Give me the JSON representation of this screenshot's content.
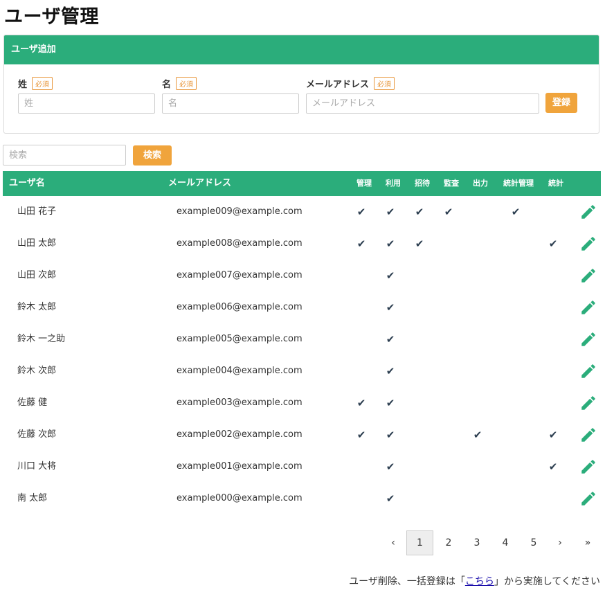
{
  "page_title": "ユーザ管理",
  "add_user": {
    "header": "ユーザ追加",
    "required_badge": "必須",
    "last_name": {
      "label": "姓",
      "placeholder": "姓"
    },
    "first_name": {
      "label": "名",
      "placeholder": "名"
    },
    "email": {
      "label": "メールアドレス",
      "placeholder": "メールアドレス"
    },
    "submit_label": "登録"
  },
  "search": {
    "placeholder": "検索",
    "button_label": "検索"
  },
  "table": {
    "columns": {
      "name": "ユーザ名",
      "email": "メールアドレス",
      "perms": [
        "管理",
        "利用",
        "招待",
        "監査",
        "出力",
        "統計管理",
        "統計"
      ]
    },
    "check_glyph": "✔",
    "rows": [
      {
        "name": "山田 花子",
        "email": "example009@example.com",
        "perms": [
          true,
          true,
          true,
          true,
          false,
          true,
          false
        ]
      },
      {
        "name": "山田 太郎",
        "email": "example008@example.com",
        "perms": [
          true,
          true,
          true,
          false,
          false,
          false,
          true
        ]
      },
      {
        "name": "山田 次郎",
        "email": "example007@example.com",
        "perms": [
          false,
          true,
          false,
          false,
          false,
          false,
          false
        ]
      },
      {
        "name": "鈴木 太郎",
        "email": "example006@example.com",
        "perms": [
          false,
          true,
          false,
          false,
          false,
          false,
          false
        ]
      },
      {
        "name": "鈴木 一之助",
        "email": "example005@example.com",
        "perms": [
          false,
          true,
          false,
          false,
          false,
          false,
          false
        ]
      },
      {
        "name": "鈴木 次郎",
        "email": "example004@example.com",
        "perms": [
          false,
          true,
          false,
          false,
          false,
          false,
          false
        ]
      },
      {
        "name": "佐藤 健",
        "email": "example003@example.com",
        "perms": [
          true,
          true,
          false,
          false,
          false,
          false,
          false
        ]
      },
      {
        "name": "佐藤 次郎",
        "email": "example002@example.com",
        "perms": [
          true,
          true,
          false,
          false,
          true,
          false,
          true
        ]
      },
      {
        "name": "川口 大将",
        "email": "example001@example.com",
        "perms": [
          false,
          true,
          false,
          false,
          false,
          false,
          true
        ]
      },
      {
        "name": "南 太郎",
        "email": "example000@example.com",
        "perms": [
          false,
          true,
          false,
          false,
          false,
          false,
          false
        ]
      }
    ]
  },
  "pagination": {
    "prev": "‹",
    "pages": [
      "1",
      "2",
      "3",
      "4",
      "5"
    ],
    "current": "1",
    "next": "›",
    "last": "»"
  },
  "footer": {
    "before": "ユーザ削除、一括登録は「",
    "link": "こちら",
    "after": "」から実施してください"
  },
  "colors": {
    "accent": "#2bad7b",
    "button": "#f0a43c",
    "check": "#2c3e50"
  },
  "icons": {
    "edit": "pencil-icon",
    "check": "check-icon"
  }
}
